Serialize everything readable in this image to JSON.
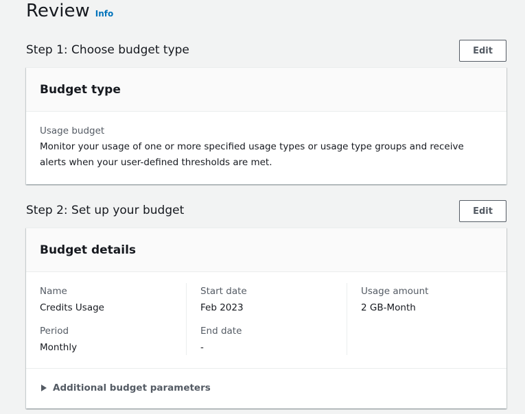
{
  "page": {
    "title": "Review",
    "info_label": "Info"
  },
  "step1": {
    "title": "Step 1: Choose budget type",
    "edit_label": "Edit",
    "container": {
      "header": "Budget type",
      "type_label": "Usage budget",
      "description": "Monitor your usage of one or more specified usage types or usage type groups and receive alerts when your user-defined thresholds are met."
    }
  },
  "step2": {
    "title": "Step 2: Set up your budget",
    "edit_label": "Edit",
    "container": {
      "header": "Budget details",
      "fields": {
        "name_label": "Name",
        "name_value": "Credits Usage",
        "period_label": "Period",
        "period_value": "Monthly",
        "start_date_label": "Start date",
        "start_date_value": "Feb 2023",
        "end_date_label": "End date",
        "end_date_value": "-",
        "usage_amount_label": "Usage amount",
        "usage_amount_value": "2 GB-Month"
      },
      "expander_label": "Additional budget parameters"
    }
  },
  "colors": {
    "link": "#0073bb",
    "text": "#16191f",
    "secondary_text": "#545b64",
    "background": "#f2f3f3"
  }
}
